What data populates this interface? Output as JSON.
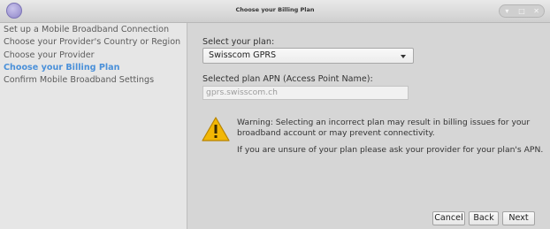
{
  "window": {
    "title": "Choose your Billing Plan",
    "controls": {
      "minimize": "▾",
      "maximize": "□",
      "close": "✕"
    }
  },
  "sidebar": {
    "steps": [
      {
        "label": "Set up a Mobile Broadband Connection",
        "active": false
      },
      {
        "label": "Choose your Provider's Country or Region",
        "active": false
      },
      {
        "label": "Choose your Provider",
        "active": false
      },
      {
        "label": "Choose your Billing Plan",
        "active": true
      },
      {
        "label": "Confirm Mobile Broadband Settings",
        "active": false
      }
    ]
  },
  "main": {
    "plan_label": "Select your plan:",
    "plan_selected": "Swisscom GPRS",
    "apn_label": "Selected plan APN (Access Point Name):",
    "apn_value": "gprs.swisscom.ch",
    "warning_text": "Warning: Selecting an incorrect plan may result in billing issues for your broadband account or may prevent connectivity.",
    "help_text": "If you are unsure of your plan please ask your provider for your plan's APN."
  },
  "buttons": {
    "cancel": "Cancel",
    "back": "Back",
    "next": "Next"
  },
  "colors": {
    "accent": "#4a90d9",
    "warning": "#f2b705"
  },
  "icons": {
    "warning": "warning-icon",
    "dropdown": "chevron-down-icon"
  }
}
